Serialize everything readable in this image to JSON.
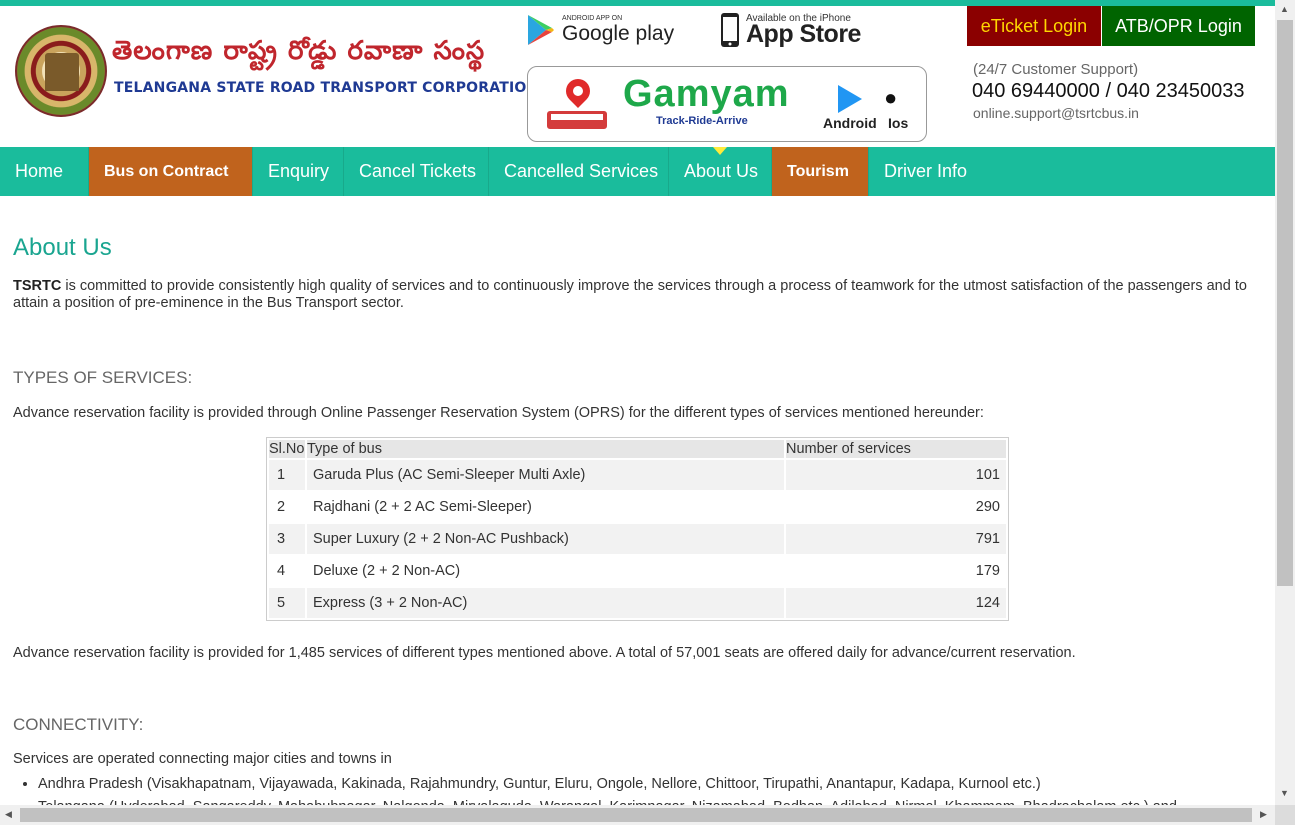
{
  "header": {
    "org_telugu": "తెలంగాణ  రాష్ట్ర రోడ్డు రవాణా సంస్థ",
    "org_english": "TELANGANA STATE ROAD TRANSPORT CORPORATION",
    "google_play_small": "ANDROID APP ON",
    "google_play_big": "Google play",
    "app_store_small": "Available on the iPhone",
    "app_store_big": "App Store",
    "gamyam_title": "Gamyam",
    "gamyam_tagline": "Track-Ride-Arrive",
    "gamyam_android": "Android",
    "gamyam_ios": "Ios",
    "eticket_login": "eTicket Login",
    "atb_login": "ATB/OPR Login",
    "support_label": "(24/7 Customer Support)",
    "support_phone": "040 69440000 / 040 23450033",
    "support_email": "online.support@tsrtcbus.in"
  },
  "nav": {
    "items": [
      {
        "label": "Home"
      },
      {
        "label": "Bus on Contract"
      },
      {
        "label": "Enquiry"
      },
      {
        "label": "Cancel Tickets"
      },
      {
        "label": "Cancelled Services"
      },
      {
        "label": "About Us"
      },
      {
        "label": "Tourism"
      },
      {
        "label": "Driver Info"
      }
    ]
  },
  "content": {
    "title": "About Us",
    "intro_bold": "TSRTC",
    "intro_text": " is committed to provide consistently high quality of services and to continuously improve the services through a process of teamwork for the utmost satisfaction of the passengers and to attain a position of pre-eminence in the Bus Transport sector.",
    "services_heading": "TYPES OF SERVICES:",
    "services_para": "Advance reservation facility is provided through Online Passenger Reservation System (OPRS) for the different types of services mentioned hereunder:",
    "table": {
      "headers": [
        "Sl.No",
        "Type of bus",
        "Number of services"
      ],
      "rows": [
        {
          "sl": "1",
          "type": "Garuda Plus (AC Semi-Sleeper Multi Axle)",
          "count": "101"
        },
        {
          "sl": "2",
          "type": "Rajdhani (2 + 2 AC Semi-Sleeper)",
          "count": "290"
        },
        {
          "sl": "3",
          "type": "Super Luxury (2 + 2 Non-AC Pushback)",
          "count": "791"
        },
        {
          "sl": "4",
          "type": "Deluxe (2 + 2 Non-AC)",
          "count": "179"
        },
        {
          "sl": "5",
          "type": "Express (3 + 2 Non-AC)",
          "count": "124"
        }
      ]
    },
    "summary_para": "Advance reservation facility is provided for 1,485 services of different types mentioned above. A total of 57,001 seats are offered daily for advance/current reservation.",
    "connectivity_heading": "CONNECTIVITY:",
    "connectivity_para": "Services are operated connecting major cities and towns in",
    "connectivity_items": [
      "Andhra Pradesh (Visakhapatnam, Vijayawada, Kakinada, Rajahmundry, Guntur, Eluru, Ongole, Nellore, Chittoor, Tirupathi, Anantapur, Kadapa, Kurnool etc.)",
      "Telangana (Hyderabad, Sangareddy, Mahabubnagar, Nalgonda, Miryalaguda, Warangal, Karimnagar, Nizamabad, Bodhan, Adilabad, Nirmal, Khammam, Bhadrachalam etc.) and"
    ]
  },
  "colors": {
    "accent": "#1abc9c",
    "highlight_nav": "#c0631d",
    "eticket_bg": "#8b0000",
    "atb_bg": "#006400",
    "title": "#1aa590"
  }
}
